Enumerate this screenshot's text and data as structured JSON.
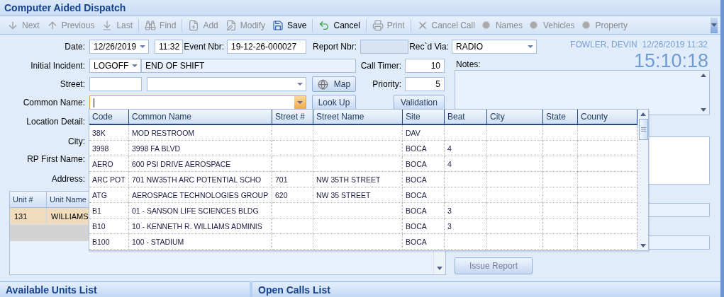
{
  "window": {
    "title": "Computer Aided Dispatch"
  },
  "toolbar": [
    {
      "kind": "down",
      "label": "Next",
      "disabled": true
    },
    {
      "kind": "up",
      "label": "Previous",
      "disabled": true
    },
    {
      "kind": "last",
      "label": "Last",
      "disabled": true
    },
    {
      "kind": "separator"
    },
    {
      "kind": "find",
      "label": "Find",
      "disabled": true
    },
    {
      "kind": "separator"
    },
    {
      "kind": "add",
      "label": "Add",
      "disabled": true
    },
    {
      "kind": "modify",
      "label": "Modify",
      "disabled": true
    },
    {
      "kind": "save",
      "label": "Save",
      "disabled": false
    },
    {
      "kind": "separator"
    },
    {
      "kind": "undo",
      "label": "Cancel",
      "disabled": false
    },
    {
      "kind": "separator"
    },
    {
      "kind": "print",
      "label": "Print",
      "disabled": true
    },
    {
      "kind": "separator"
    },
    {
      "kind": "close",
      "label": "Cancel Call",
      "disabled": true
    },
    {
      "kind": "radio",
      "label": "Names",
      "disabled": true
    },
    {
      "kind": "radio",
      "label": "Vehicles",
      "disabled": true
    },
    {
      "kind": "radio",
      "label": "Property",
      "disabled": true
    }
  ],
  "date": {
    "label": "Date:",
    "value": "12/26/2019",
    "time": "11:32"
  },
  "event_nbr": {
    "label": "Event Nbr:",
    "value": "19-12-26-000027"
  },
  "report_nbr": {
    "label": "Report Nbr:",
    "disabled": true
  },
  "recd_via": {
    "label": "Rec`d Via:",
    "value": "RADIO"
  },
  "user": {
    "name": "FOWLER, DEVIN",
    "datetime": "12/26/2019 11:32",
    "clock": "15:10:18"
  },
  "initial_incident": {
    "label": "Initial Incident:",
    "code": "LOGOFF",
    "description": "END OF SHIFT"
  },
  "call_timer": {
    "label": "Call Timer:",
    "value": "10"
  },
  "street": {
    "label": "Street:",
    "map_button": "Map"
  },
  "priority": {
    "label": "Priority:",
    "value": "5"
  },
  "common_name": {
    "label": "Common Name:",
    "focused": true,
    "look_up_button": "Look Up"
  },
  "validation_button": "Validation",
  "more_fields": [
    {
      "label": "Location Detail:"
    },
    {
      "label": "City:"
    },
    {
      "label": "RP First Name:"
    },
    {
      "label": "Address:"
    }
  ],
  "notes": {
    "label": "Notes:"
  },
  "units_table": {
    "columns": [
      "Unit #",
      "Unit Name"
    ],
    "rows": [
      {
        "unit": "131",
        "name": "WILLIAMS",
        "selected": true
      }
    ],
    "new_row": true
  },
  "issue_report_button": {
    "label": "Issue Report",
    "disabled": true
  },
  "lookup_grid": {
    "columns": [
      "Code",
      "Common Name",
      "Street #",
      "Street Name",
      "Site",
      "Beat",
      "City",
      "State",
      "County"
    ],
    "rows": [
      {
        "code": "38K",
        "common_name": "MOD RESTROOM",
        "site": "DAV"
      },
      {
        "code": "3998",
        "common_name": "3998 FA BLVD",
        "site": "BOCA",
        "beat": "4"
      },
      {
        "code": "AERO",
        "common_name": "600 PSI DRIVE AEROSPACE",
        "site": "BOCA",
        "beat": "4"
      },
      {
        "code": "ARC POT",
        "common_name": "701 NW35TH ARC POTENTIAL SCHO",
        "street_no": "701",
        "street_name": "NW 35TH STREET",
        "site": "BOCA"
      },
      {
        "code": "ATG",
        "common_name": "AEROSPACE TECHNOLOGIES GROUP",
        "street_no": "620",
        "street_name": "NW 35 STREET",
        "site": "BOCA"
      },
      {
        "code": "B1",
        "common_name": "01 - SANSON LIFE SCIENCES BLDG",
        "site": "BOCA",
        "beat": "3"
      },
      {
        "code": "B10",
        "common_name": "10 - KENNETH R. WILLIAMS ADMINIS",
        "site": "BOCA",
        "beat": "3"
      },
      {
        "code": "B100",
        "common_name": "100 - STADIUM",
        "site": "BOCA"
      }
    ]
  },
  "panels": [
    "Available Units List",
    "Open Calls List"
  ]
}
